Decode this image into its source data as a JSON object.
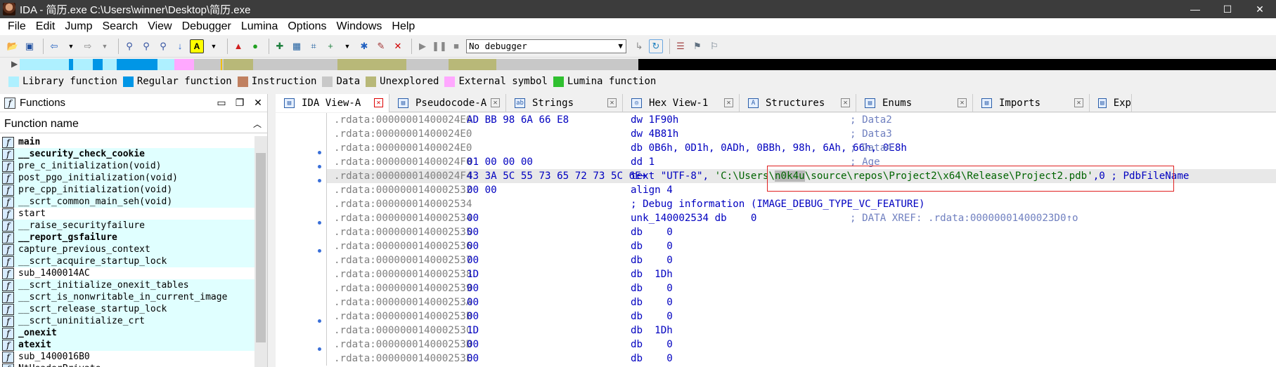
{
  "window": {
    "title": "IDA - 简历.exe C:\\Users\\winner\\Desktop\\简历.exe",
    "controls": [
      "—",
      "☐",
      "✕"
    ]
  },
  "menu": [
    "File",
    "Edit",
    "Jump",
    "Search",
    "View",
    "Debugger",
    "Lumina",
    "Options",
    "Windows",
    "Help"
  ],
  "toolbar": {
    "debugger_select": "No debugger"
  },
  "legend": [
    {
      "label": "Library function",
      "color": "#aef0ff"
    },
    {
      "label": "Regular function",
      "color": "#0096e6"
    },
    {
      "label": "Instruction",
      "color": "#c08060"
    },
    {
      "label": "Data",
      "color": "#c8c8c8"
    },
    {
      "label": "Unexplored",
      "color": "#b8b878"
    },
    {
      "label": "External symbol",
      "color": "#ffa8ff"
    },
    {
      "label": "Lumina function",
      "color": "#30c030"
    }
  ],
  "functions_panel": {
    "title": "Functions",
    "column_header": "Function name",
    "items": [
      {
        "name": "main",
        "bold": true,
        "lib": false
      },
      {
        "name": "__security_check_cookie",
        "bold": true,
        "lib": true
      },
      {
        "name": "pre_c_initialization(void)",
        "bold": false,
        "lib": true
      },
      {
        "name": "post_pgo_initialization(void)",
        "bold": false,
        "lib": true
      },
      {
        "name": "pre_cpp_initialization(void)",
        "bold": false,
        "lib": true
      },
      {
        "name": "__scrt_common_main_seh(void)",
        "bold": false,
        "lib": true
      },
      {
        "name": "start",
        "bold": false,
        "lib": false
      },
      {
        "name": "__raise_securityfailure",
        "bold": false,
        "lib": true
      },
      {
        "name": "__report_gsfailure",
        "bold": true,
        "lib": true
      },
      {
        "name": "capture_previous_context",
        "bold": false,
        "lib": true
      },
      {
        "name": "__scrt_acquire_startup_lock",
        "bold": false,
        "lib": true
      },
      {
        "name": "sub_1400014AC",
        "bold": false,
        "lib": false
      },
      {
        "name": "__scrt_initialize_onexit_tables",
        "bold": false,
        "lib": true
      },
      {
        "name": "__scrt_is_nonwritable_in_current_image",
        "bold": false,
        "lib": true
      },
      {
        "name": "__scrt_release_startup_lock",
        "bold": false,
        "lib": true
      },
      {
        "name": "__scrt_uninitialize_crt",
        "bold": false,
        "lib": true
      },
      {
        "name": "_onexit",
        "bold": true,
        "lib": true
      },
      {
        "name": "atexit",
        "bold": true,
        "lib": true
      },
      {
        "name": "sub_1400016B0",
        "bold": false,
        "lib": false
      },
      {
        "name": "NtHeaderPrivate...",
        "bold": false,
        "lib": false
      }
    ]
  },
  "tabs": [
    {
      "label": "IDA View-A",
      "active": true
    },
    {
      "label": "Pseudocode-A",
      "active": false
    },
    {
      "label": "Strings",
      "active": false
    },
    {
      "label": "Hex View-1",
      "active": false
    },
    {
      "label": "Structures",
      "active": false
    },
    {
      "label": "Enums",
      "active": false
    },
    {
      "label": "Imports",
      "active": false
    },
    {
      "label": "Exp",
      "active": false
    }
  ],
  "disasm": [
    {
      "addr": ".rdata:00000001400024E0",
      "bytes": "AD BB 98 6A 66 E8",
      "instr": "dw 1F90h",
      "cmt": "; Data2",
      "hl": false
    },
    {
      "addr": ".rdata:00000001400024E0",
      "bytes": "",
      "instr": "dw 4B81h",
      "cmt": "; Data3",
      "hl": false
    },
    {
      "addr": ".rdata:00000001400024E0",
      "bytes": "",
      "instr": "db 0B6h, 0D1h, 0ADh, 0BBh, 98h, 6Ah, 66h, 0E8h",
      "cmt": "; Data4",
      "hl": false
    },
    {
      "addr": ".rdata:00000001400024F0",
      "bytes": "01 00 00 00",
      "instr": "dd 1",
      "cmt": "; Age",
      "hl": false
    },
    {
      "addr": ".rdata:00000001400024F4",
      "bytes": "43 3A 5C 55 73 65 72 73 5C 6E+",
      "instr": "text \"UTF-8\", ",
      "str_pre": "'C:\\Users\\",
      "str_hl": "n0k4u",
      "str_post": "\\source\\repos\\Project2\\x64\\Release\\Project2.pdb'",
      "str_tail": ",0 ; PdbFileName",
      "hl": true
    },
    {
      "addr": ".rdata:0000000140002532",
      "bytes": "00 00",
      "instr": "align 4",
      "cmt": "",
      "hl": false
    },
    {
      "addr": ".rdata:0000000140002534",
      "bytes": "",
      "instr": "; Debug information (IMAGE_DEBUG_TYPE_VC_FEATURE)",
      "cmt": "",
      "hl": false
    },
    {
      "addr": ".rdata:0000000140002534",
      "bytes": "00",
      "instr": "unk_140002534 db    0",
      "cmt": "; DATA XREF: .rdata:00000001400023D0↑o",
      "hl": false
    },
    {
      "addr": ".rdata:0000000140002535",
      "bytes": "00",
      "instr": "db    0",
      "cmt": "",
      "hl": false
    },
    {
      "addr": ".rdata:0000000140002536",
      "bytes": "00",
      "instr": "db    0",
      "cmt": "",
      "hl": false
    },
    {
      "addr": ".rdata:0000000140002537",
      "bytes": "00",
      "instr": "db    0",
      "cmt": "",
      "hl": false
    },
    {
      "addr": ".rdata:0000000140002538",
      "bytes": "1D",
      "instr": "db  1Dh",
      "cmt": "",
      "hl": false
    },
    {
      "addr": ".rdata:0000000140002539",
      "bytes": "00",
      "instr": "db    0",
      "cmt": "",
      "hl": false
    },
    {
      "addr": ".rdata:000000014000253A",
      "bytes": "00",
      "instr": "db    0",
      "cmt": "",
      "hl": false
    },
    {
      "addr": ".rdata:000000014000253B",
      "bytes": "00",
      "instr": "db    0",
      "cmt": "",
      "hl": false
    },
    {
      "addr": ".rdata:000000014000253C",
      "bytes": "1D",
      "instr": "db  1Dh",
      "cmt": "",
      "hl": false
    },
    {
      "addr": ".rdata:000000014000253D",
      "bytes": "00",
      "instr": "db    0",
      "cmt": "",
      "hl": false
    },
    {
      "addr": ".rdata:000000014000253E",
      "bytes": "00",
      "instr": "db    0",
      "cmt": "",
      "hl": false
    }
  ]
}
